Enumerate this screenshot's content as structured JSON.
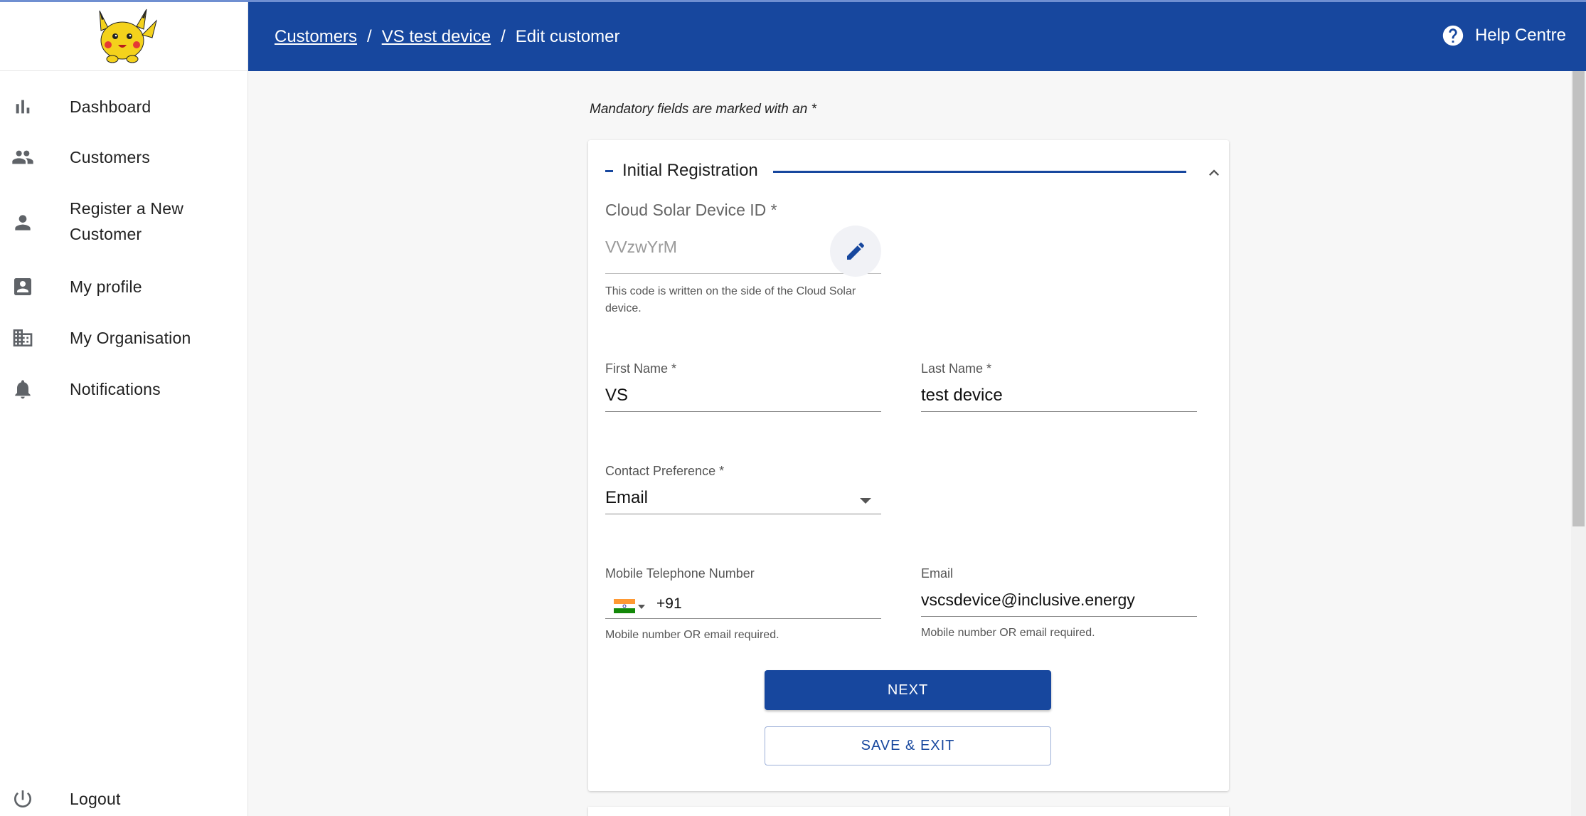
{
  "header": {
    "breadcrumbs": [
      {
        "label": "Customers"
      },
      {
        "label": "VS test device"
      },
      {
        "label": "Edit customer"
      }
    ],
    "separator": "/",
    "help_label": "Help Centre"
  },
  "sidebar": {
    "items": [
      {
        "label": "Dashboard",
        "icon": "bar-chart-icon"
      },
      {
        "label": "Customers",
        "icon": "people-icon"
      },
      {
        "label": "Register a New Customer",
        "icon": "person-icon"
      },
      {
        "label": "My profile",
        "icon": "contact-card-icon"
      },
      {
        "label": "My Organisation",
        "icon": "building-icon"
      },
      {
        "label": "Notifications",
        "icon": "bell-icon"
      }
    ],
    "logout_label": "Logout"
  },
  "form": {
    "mandatory_note": "Mandatory fields are marked with an *",
    "section_title": "Initial Registration",
    "device_id": {
      "label": "Cloud Solar Device ID *",
      "value": "VVzwYrM",
      "helper": "This code is written on the side of the Cloud Solar device."
    },
    "first_name": {
      "label": "First Name *",
      "value": "VS"
    },
    "last_name": {
      "label": "Last Name *",
      "value": "test device"
    },
    "contact_preference": {
      "label": "Contact Preference *",
      "value": "Email"
    },
    "mobile": {
      "label": "Mobile Telephone Number",
      "dial_code": "+91",
      "helper": "Mobile number OR email required."
    },
    "email": {
      "label": "Email",
      "value": "vscsdevice@inclusive.energy",
      "helper": "Mobile number OR email required."
    },
    "next_label": "NEXT",
    "save_exit_label": "SAVE & EXIT"
  },
  "colors": {
    "brand": "#17479e",
    "background": "#f7f7f7"
  }
}
